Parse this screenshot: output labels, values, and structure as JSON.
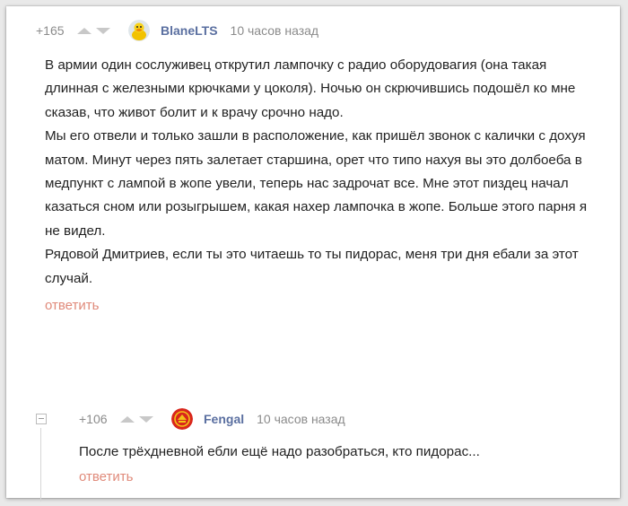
{
  "comment": {
    "rating": "+165",
    "username": "BlaneLTS",
    "time": "10 часов назад",
    "avatar_icon": "duck-avatar-icon",
    "paragraphs": [
      "В армии один сослуживец открутил лампочку с радио оборудовагия (она такая длинная с железными крючками у цоколя). Ночью он скрючившись подошёл ко мне сказав, что живот болит и к врачу срочно надо.",
      "Мы его отвели и только зашли в расположение, как пришёл звонок с калички с дохуя матом. Минут через пять залетает старшина, орет что типо нахуя вы это долбоеба в медпункт с лампой в жопе увели, теперь нас задрочат все. Мне этот пиздец начал казаться сном или розыгрышем, какая нахер лампочка в жопе. Больше этого парня я не видел.",
      "Рядовой Дмитриев, если ты это читаешь то ты пидорас, меня три дня ебали за этот случай."
    ],
    "reply_label": "ответить"
  },
  "reply": {
    "rating": "+106",
    "username": "Fengal",
    "time": "10 часов назад",
    "avatar_icon": "emblem-avatar-icon",
    "text": "После трёхдневной ебли ещё надо разобраться, кто пидорас...",
    "reply_label": "ответить"
  },
  "colors": {
    "username": "#5a6fa0",
    "reply_link": "#e08a7a",
    "meta": "#8b8b8b"
  }
}
